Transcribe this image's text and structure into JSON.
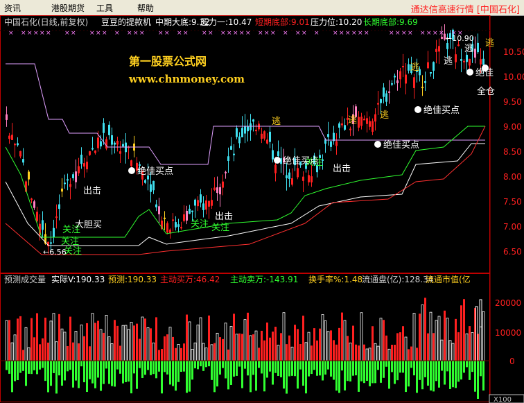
{
  "menu": {
    "items": [
      "资讯",
      "港股期货",
      "工具",
      "帮助"
    ],
    "title": "通达信高速行情 [中国石化]"
  },
  "main_header": {
    "stock": "中国石化(日线,前复权)",
    "indicator": "豆豆的提款机",
    "mid_bottom": "中期大底:9.32",
    "pressure1": "压力一:10.47",
    "short_bottom": "短期底部:9.01",
    "pressure_level": "压力位:10.20",
    "long_bottom": "长期底部:9.69"
  },
  "watermark": {
    "line1": "第一股票公式网",
    "line2": "www.chnmoney.com"
  },
  "price_axis": [
    "10.50",
    "10.00",
    "9.50",
    "9.00",
    "8.50",
    "8.00",
    "7.50",
    "7.00",
    "6.50"
  ],
  "price_extremes": {
    "high": "10.90",
    "low": "6.56"
  },
  "annotations": {
    "escape": "逃",
    "exit": "出击",
    "attention": "关注",
    "bold_buy": "大胆买",
    "best_buy": "绝佳买点",
    "all_in": "全仓",
    "best_short": "绝佳"
  },
  "volume_header": {
    "title": "预测成交量",
    "actual": "实际V:190.33",
    "predicted": "预测:190.33",
    "active_buy": "主动买万:46.42",
    "active_sell": "主动卖万:-143.91",
    "turnover": "换手率%:1.48",
    "float_shares": "流通盘(亿):128.34",
    "float_value": "流通市值(亿"
  },
  "volume_axis": [
    "20000",
    "10000",
    "0"
  ],
  "volume_unit": "X100",
  "colors": {
    "up": "#ff2020",
    "down": "#40e0f0",
    "pink": "#ff80c0",
    "yellow": "#ffd020",
    "ma_line": "#ff80ff",
    "green_line": "#30ff30",
    "white_line": "#ffffff",
    "red_line": "#ff2020",
    "axis": "#c00000"
  }
}
